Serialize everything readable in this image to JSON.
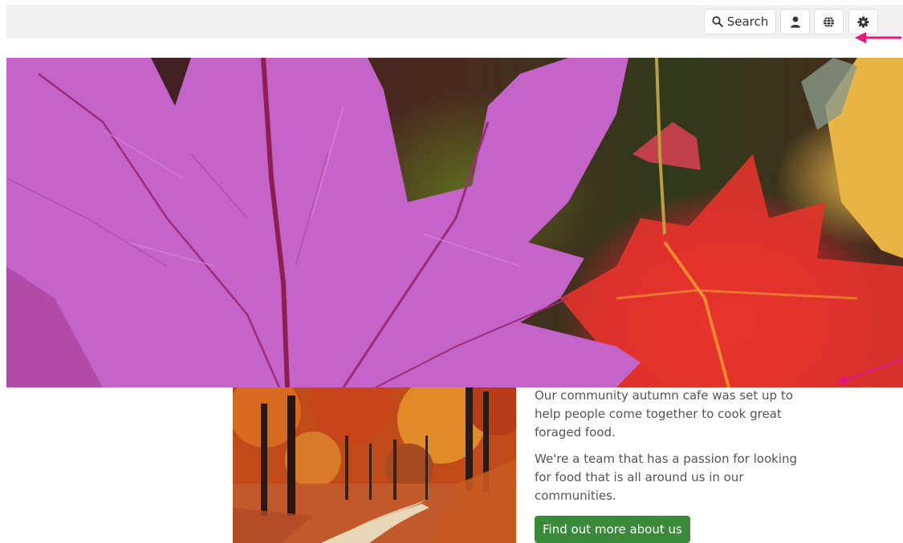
{
  "topbar": {
    "search_label": "Search",
    "icons": {
      "search": "search-icon",
      "user": "user-icon",
      "globe": "globe-icon",
      "settings": "gear-icon"
    }
  },
  "intro": {
    "paragraph_1": "Our community autumn cafe was set up to help people come together to cook great foraged food.",
    "paragraph_2": "We're a team that has a passion for looking for food that is all around us in our communities.",
    "cta_label": "Find out more about us"
  },
  "colors": {
    "cta_background": "#3a8a3a",
    "annotation_arrow": "#e0197a",
    "topbar_background": "#f1f1f1"
  }
}
